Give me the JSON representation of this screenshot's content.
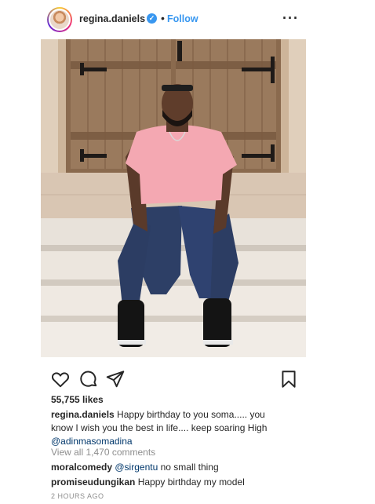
{
  "header": {
    "username": "regina.daniels",
    "verified_icon": "verified-badge-icon",
    "separator": "•",
    "follow_label": "Follow",
    "more_label": "···"
  },
  "photo": {
    "description_icon": "post-photo"
  },
  "actions": {
    "like_icon": "heart-icon",
    "comment_icon": "comment-icon",
    "share_icon": "paper-plane-icon",
    "save_icon": "bookmark-icon"
  },
  "likes": "55,755 likes",
  "caption": {
    "username": "regina.daniels",
    "text": "Happy birthday to you soma..... you know I wish you the best in life.... keep soaring High",
    "mention": "@adinmasomadina"
  },
  "view_all_comments": "View all 1,470 comments",
  "comments": [
    {
      "username": "moralcomedy",
      "mention": "@sirgentu",
      "text": "no small thing"
    },
    {
      "username": "promiseudungikan",
      "mention": "",
      "text": "Happy birthday my model"
    }
  ],
  "timestamp": "2 HOURS AGO",
  "colors": {
    "accent": "#3897f0",
    "text": "#262626",
    "muted": "#8e8e8e",
    "mention": "#00376b"
  }
}
